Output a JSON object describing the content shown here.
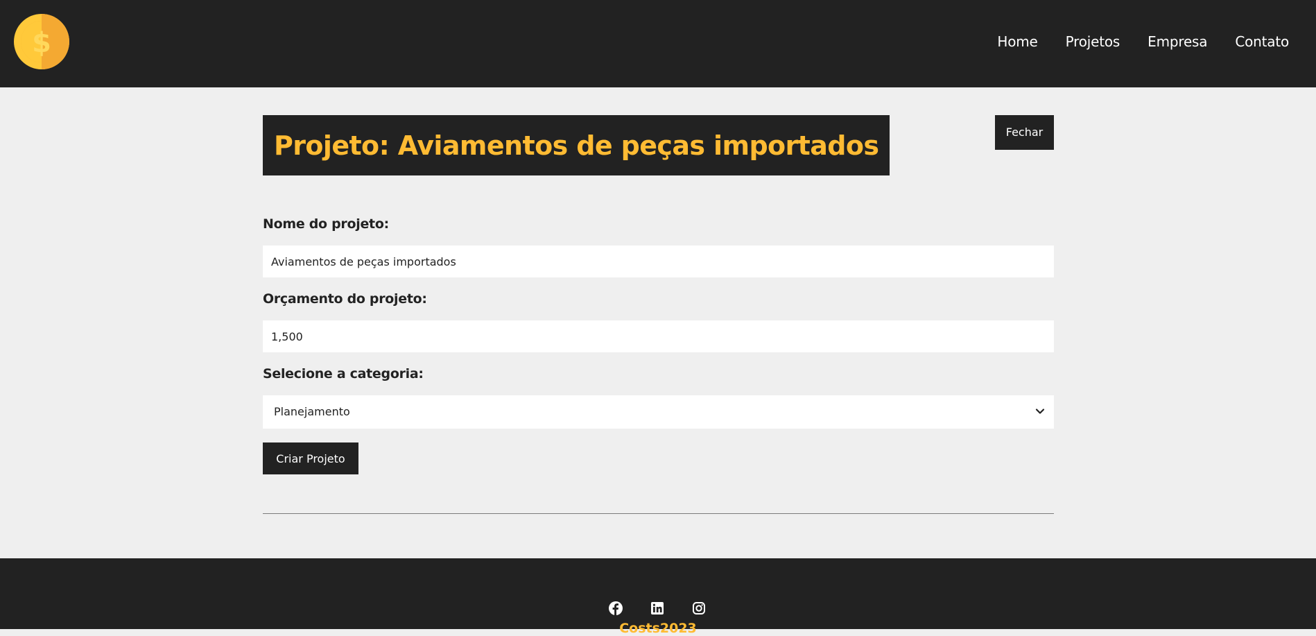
{
  "nav": {
    "items": [
      {
        "label": "Home"
      },
      {
        "label": "Projetos"
      },
      {
        "label": "Empresa"
      },
      {
        "label": "Contato"
      }
    ]
  },
  "header": {
    "title": "Projeto: Aviamentos de peças importados",
    "close_label": "Fechar"
  },
  "form": {
    "name_label": "Nome do projeto:",
    "name_value": "Aviamentos de peças importados",
    "budget_label": "Orçamento do projeto:",
    "budget_value": "1,500",
    "category_label": "Selecione a categoria:",
    "category_value": "Planejamento",
    "submit_label": "Criar Projeto"
  },
  "footer": {
    "social": [
      "facebook-icon",
      "linkedin-icon",
      "instagram-icon"
    ],
    "copyright": "Costs2023"
  },
  "colors": {
    "dark": "#222222",
    "accent": "#ffbb33",
    "background": "#efefef"
  }
}
